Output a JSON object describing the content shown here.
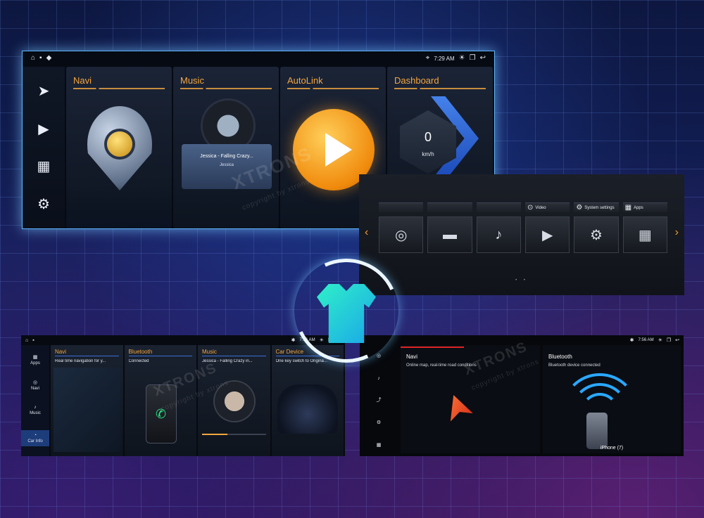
{
  "screen_a": {
    "statusbar": {
      "time": "7:29 AM"
    },
    "sidebar_icons": [
      "navigation-icon",
      "play-icon",
      "apps-icon",
      "settings-icon"
    ],
    "tiles": [
      {
        "title": "Navi"
      },
      {
        "title": "Music",
        "song": "Jessica - Falling Crazy...",
        "artist": "Jessica"
      },
      {
        "title": "AutoLink"
      },
      {
        "title": "Dashboard",
        "speed_value": "0",
        "speed_unit": "km/h"
      }
    ]
  },
  "screen_b": {
    "chips": [
      {
        "label": ""
      },
      {
        "label": "Video"
      },
      {
        "label": "System settings"
      },
      {
        "label": "Apps"
      }
    ]
  },
  "screen_c": {
    "statusbar": {
      "time": "7:56 AM"
    },
    "sidebar": [
      {
        "label": "Apps"
      },
      {
        "label": "Navi"
      },
      {
        "label": "Music"
      },
      {
        "label": "Car Info"
      }
    ],
    "tiles": [
      {
        "title": "Navi",
        "subtitle": "Real time navigation for y..."
      },
      {
        "title": "Bluetooth",
        "subtitle": "Connected"
      },
      {
        "title": "Music",
        "subtitle": "Jessica - Falling Crazy in..."
      },
      {
        "title": "Car Device",
        "subtitle": "One key switch to Origina..."
      }
    ]
  },
  "screen_d": {
    "statusbar": {
      "time": "7:56 AM"
    },
    "panels": [
      {
        "title": "Navi",
        "subtitle": "Online map, real-time road conditions"
      },
      {
        "title": "Bluetooth",
        "subtitle": "Bluetooth device connected",
        "device": "iPhone (7)"
      }
    ]
  },
  "watermark": {
    "brand": "XTRONS",
    "sub": "copyright by xtrons"
  },
  "colors": {
    "accent": "#f3a640",
    "glow": "#5fb6ff"
  }
}
